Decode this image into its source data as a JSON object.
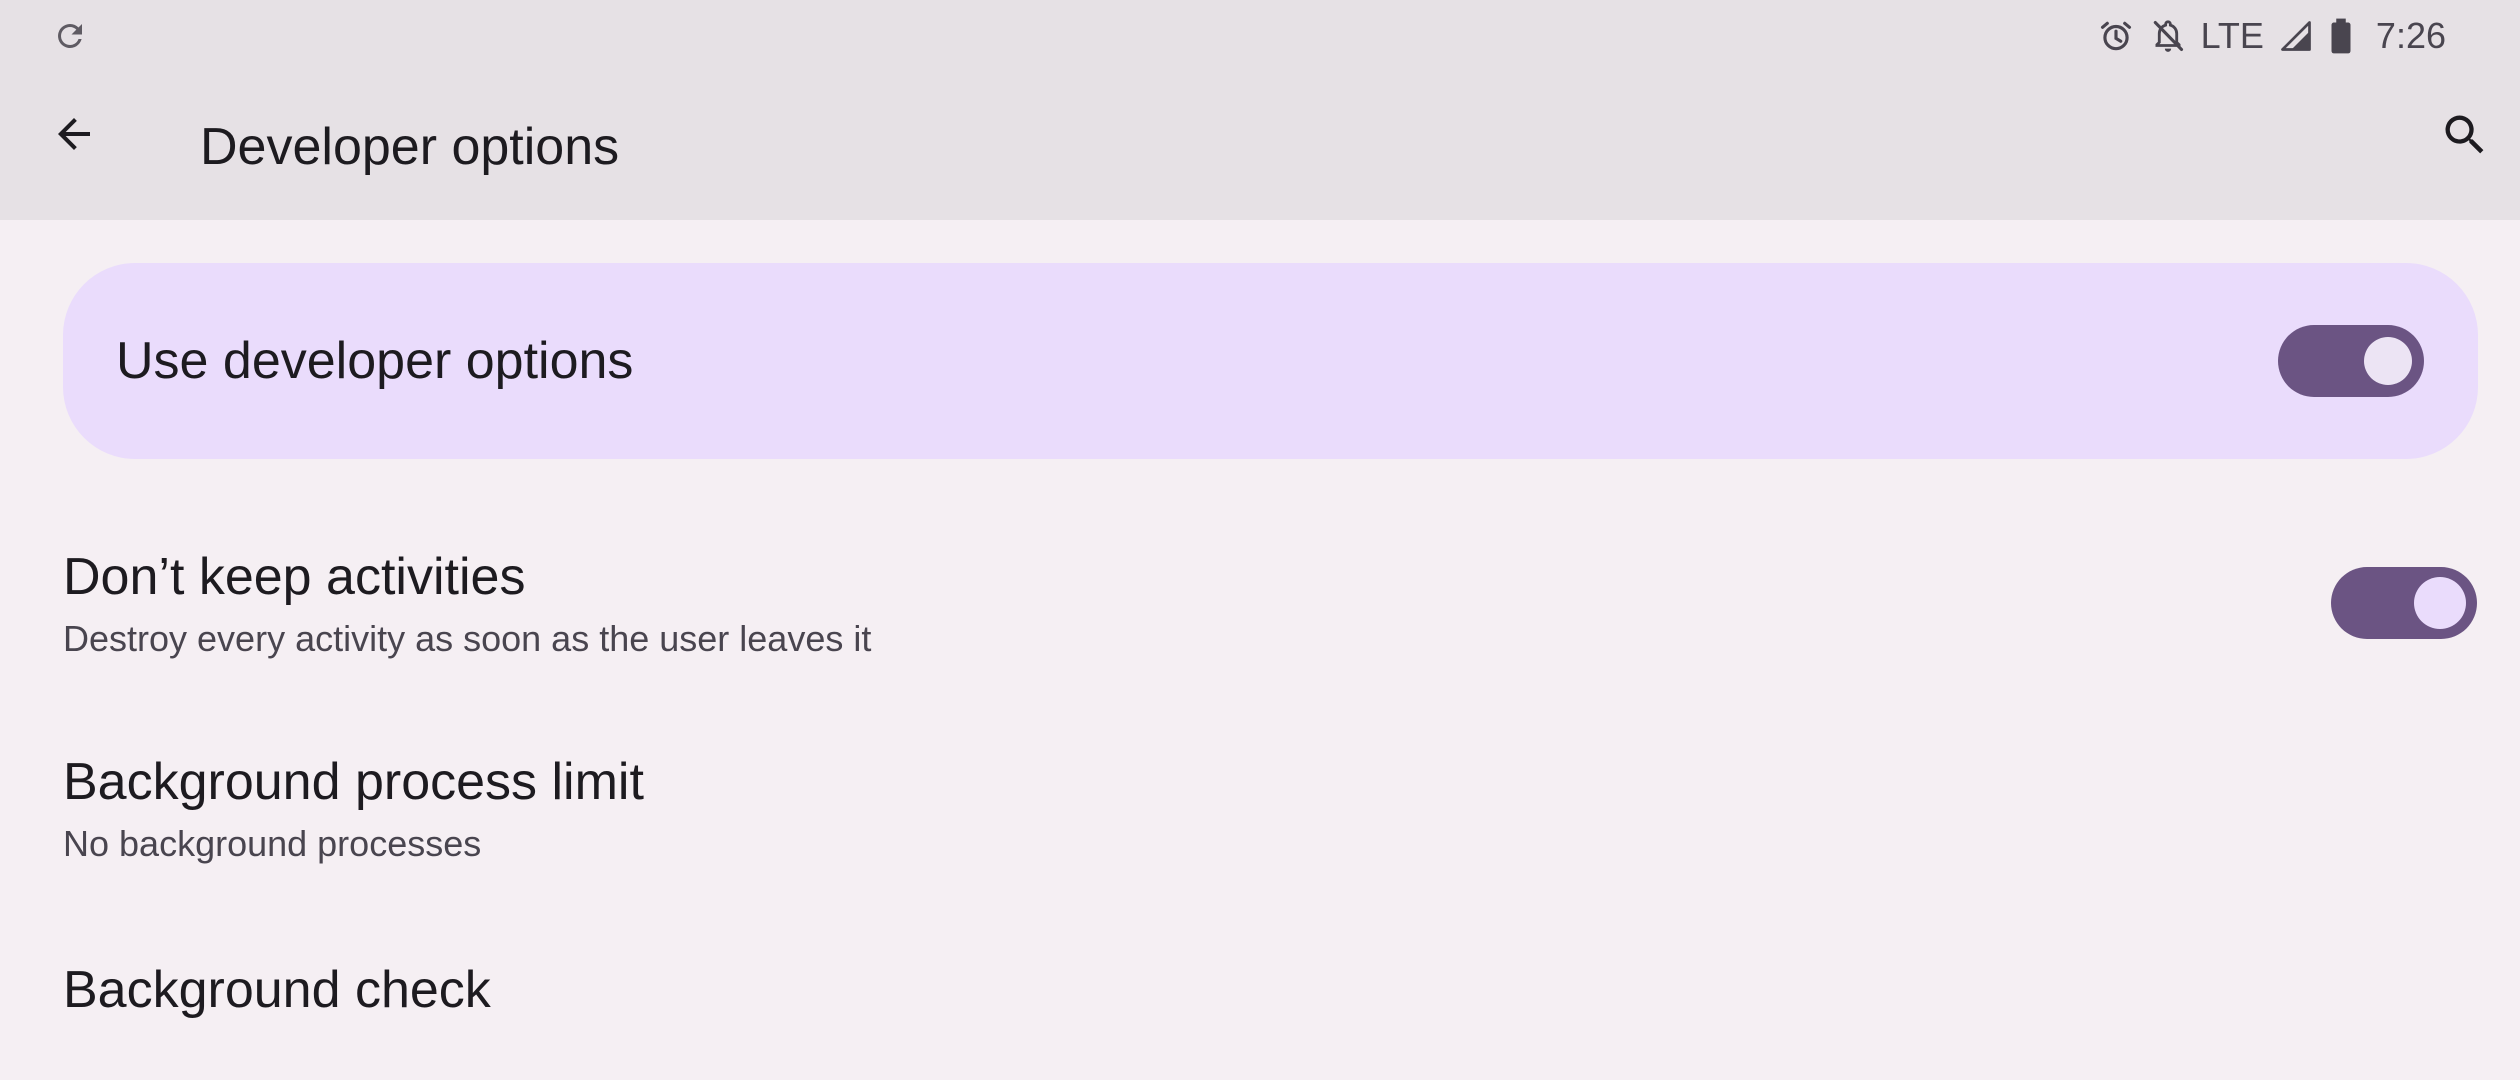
{
  "status_bar": {
    "network": "LTE",
    "time": "7:26"
  },
  "app_bar": {
    "title": "Developer options"
  },
  "main_switch": {
    "label": "Use developer options",
    "on": true
  },
  "settings": [
    {
      "title": "Don’t keep activities",
      "summary": "Destroy every activity as soon as the user leaves it",
      "switch_on": true
    },
    {
      "title": "Background process limit",
      "summary": "No background processes"
    },
    {
      "title": "Background check"
    }
  ],
  "icons": {
    "status_left": "refresh-icon",
    "status_right": [
      "alarm-icon",
      "bell-off-icon",
      "signal-icon",
      "battery-icon"
    ],
    "back": "arrow-back-icon",
    "search": "search-icon"
  },
  "colors": {
    "top_bar": "#e6e1e5",
    "background": "#f5eff3",
    "card": "#eadcfc",
    "switch_track": "#6b5483"
  }
}
